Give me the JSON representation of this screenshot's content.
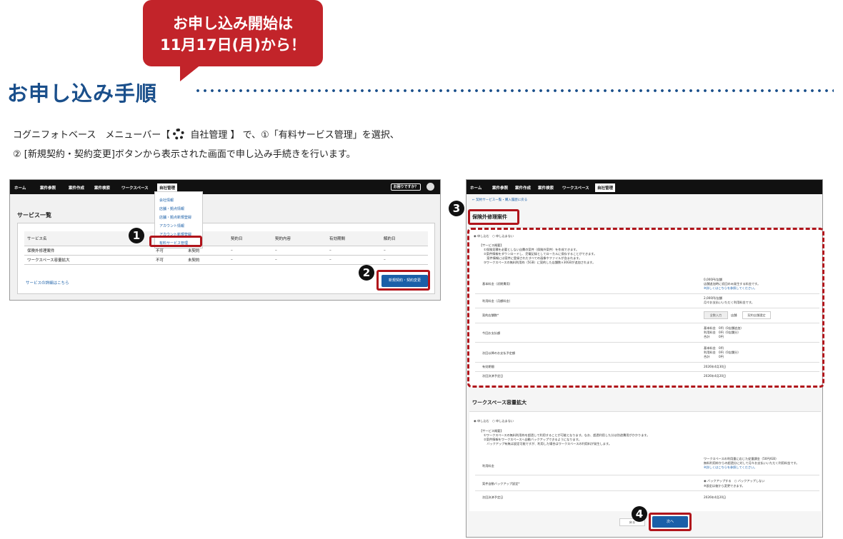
{
  "bubble": {
    "line1": "お申し込み開始は",
    "line2": "11月17日(月)から！"
  },
  "title": "お申し込み手順",
  "desc": {
    "line1_pre": "コグニフォトベース　メニューバー【",
    "line1_post": " 自社管理 】 で、①「有料サービス管理」を選択、",
    "line2": "② [新規契約・契約変更]ボタンから表示された画面で申し込み手続きを行います。"
  },
  "nav": {
    "home": "ホーム",
    "ref": "案件参照",
    "create": "案件作成",
    "search": "案件検索",
    "workspace": "ワークスペース",
    "admin": "自社管理",
    "help": "お困りですか？"
  },
  "screen1": {
    "title": "サービス一覧",
    "columns": [
      "サービス名",
      "",
      "",
      "契約日",
      "契約内容",
      "有効期間",
      "解約日"
    ],
    "rows": [
      [
        "保険外修理案件",
        "不可",
        "未契約",
        "–",
        "–",
        "–",
        "–"
      ],
      [
        "ワークスペース容量拡大",
        "不可",
        "未契約",
        "–",
        "–",
        "–",
        "–"
      ]
    ],
    "detail_link": "サービスの詳細はこちら",
    "new_button": "新規契約・契約変更",
    "menu": [
      "会社情報",
      "店舗・拠点情報",
      "店舗・拠点新規登録",
      "アカウント情報",
      "アカウント新規登録",
      "有料サービス管理"
    ]
  },
  "badges": {
    "b1": "1",
    "b2": "2",
    "b3": "3",
    "b4": "4"
  },
  "screen2": {
    "crumb": "← 契約サービス一覧・購入履歴に戻る",
    "sec1_title": "保険外修理案件",
    "apply": "申し込む",
    "noapply": "申し込まない",
    "overview_head": "【サービス概要】",
    "overview": [
      "①保険見積を必要としない自費の案件（保険外案件）を作成できます。",
      "②案件情報をダウンロードし、売電記録としてローカルに保存することができます。",
      "　案件情報には案件に登録されたすべての画像やファイルが含まれます。",
      "③ワークスペースの無料利用枠（5GB）に契約した店舗数×30GBが追加されます。"
    ],
    "fee_basic_label": "基本料金（初期費用）",
    "fee_basic_value": "0,000円/店舗",
    "fee_basic_note": "店舗追加時に初回のみ発生する料金です。",
    "fee_basic_link": "※詳しくはこちらを参照してください。",
    "fee_month_label": "利用料金（月額料金）",
    "fee_month_value": "2,000円/店舗",
    "fee_month_note": "月々お支払いいただく利用料金です。",
    "stores_label": "契約店舗数*",
    "stores_input": "全数入力",
    "stores_unit": "店舗",
    "stores_btn": "契約店舗選定",
    "pay_now_label": "今回お支払額",
    "pay_now": [
      "基本料金　0円（0店舗追加）",
      "利用料金　0円（0店舗分）",
      "合計　　　0円"
    ],
    "pay_next_label": "次回以降のお支払予定額",
    "pay_next": [
      "基本料金　0円",
      "利用料金　0円（0店舗分）",
      "合計　　　0円"
    ],
    "valid_label": "有効期間",
    "valid_value": "2026年4月30日",
    "next_pay_label": "次回決済予定日",
    "next_pay_value": "2026年4月20日",
    "sec2_title": "ワークスペース容量拡大",
    "overview2": [
      "①ワークスペースの無料利用枠を超過して利用することが可能となります。なお、超過利用した分は別途費用がかかります。",
      "②案件情報をワークスペースへ自動バックアップできるようになります。",
      "　バックアップ有無は設定可能ですが、利用した場合はワークスペースの利用料が発生します。"
    ],
    "ws_fee_label": "利用料金",
    "ws_fee_value": "ワークスペースの利用量に応じた従量課金（50円/GB）",
    "ws_fee_note": "無料利用枠からの超過分に対して月々お支払いいただく利用料金です。",
    "ws_fee_link": "※詳しくはこちらを参照してください。",
    "backup_label": "案件自動バックアップ設定*",
    "backup_on": "バックアップする",
    "backup_off": "バックアップしない",
    "backup_note": "※設定は後から変更できます。",
    "ws_next_label": "次回決済予定日",
    "ws_next_value": "2026年4月20日",
    "back_btn": "戻る",
    "next_btn": "次へ"
  }
}
